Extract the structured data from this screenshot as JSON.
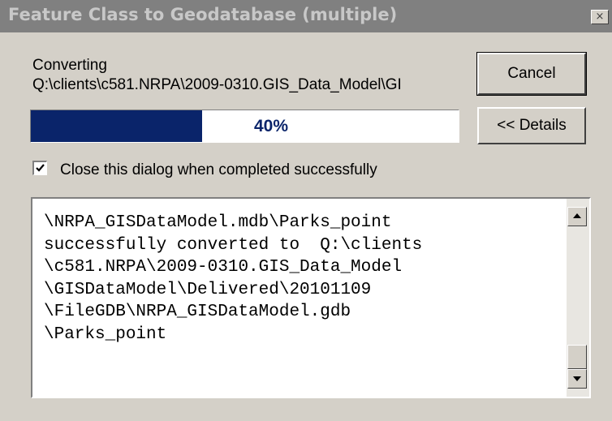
{
  "window": {
    "title": "Feature Class to Geodatabase (multiple)",
    "close_glyph": "×"
  },
  "status": {
    "label": "Converting",
    "path": "Q:\\clients\\c581.NRPA\\2009-0310.GIS_Data_Model\\GI"
  },
  "progress": {
    "value": 0.4,
    "text": "40%",
    "fill_color": "#0a246a"
  },
  "buttons": {
    "cancel": "Cancel",
    "details": "<< Details"
  },
  "checkbox": {
    "label": "Close this dialog when completed successfully",
    "checked": true
  },
  "log": {
    "text": "\\NRPA_GISDataModel.mdb\\Parks_point\nsuccessfully converted to  Q:\\clients\n\\c581.NRPA\\2009-0310.GIS_Data_Model\n\\GISDataModel\\Delivered\\20101109\n\\FileGDB\\NRPA_GISDataModel.gdb\n\\Parks_point"
  }
}
